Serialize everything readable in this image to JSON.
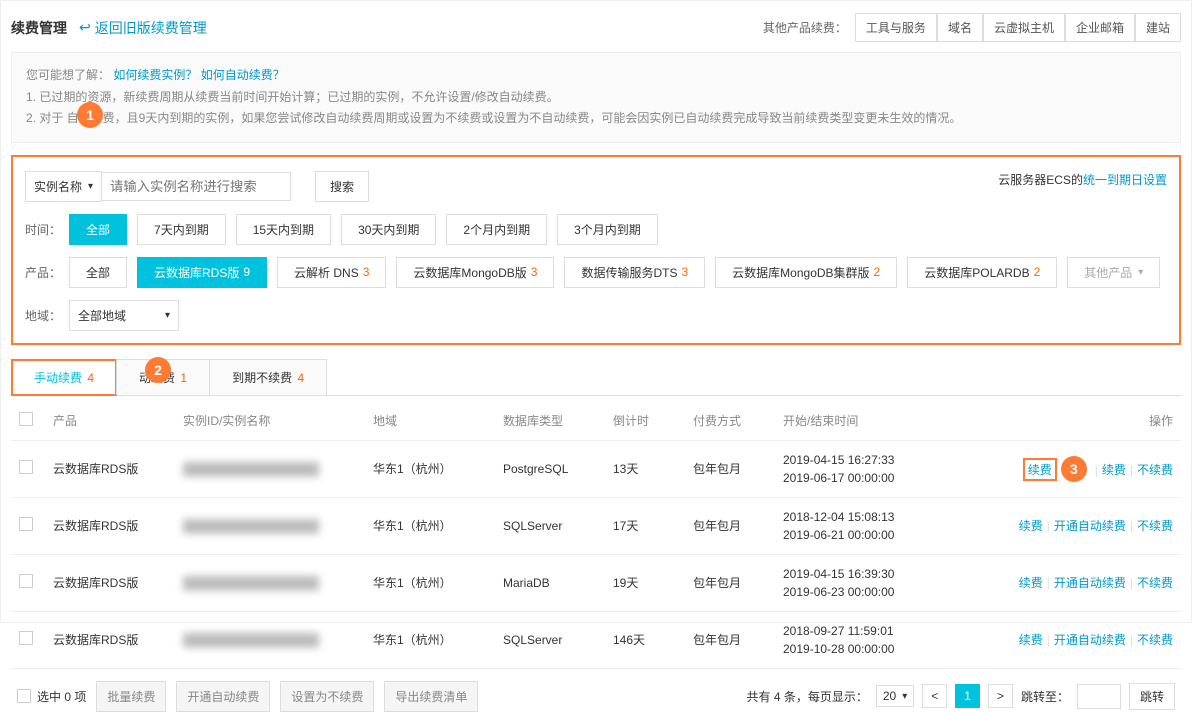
{
  "header": {
    "page_title": "续费管理",
    "back_link": "返回旧版续费管理",
    "other_products_label": "其他产品续费：",
    "tabs": [
      "工具与服务",
      "域名",
      "云虚拟主机",
      "企业邮箱",
      "建站"
    ]
  },
  "info": {
    "intro": "您可能想了解：",
    "link1": "如何续费实例？",
    "link2": "如何自动续费？",
    "line1": "1. 已过期的资源，新续费周期从续费当前时间开始计算；已过期的实例，不允许设置/修改自动续费。",
    "line2": "2. 对于       自动续费，且9天内到期的实例，如果您尝试修改自动续费周期或设置为不续费或设置为不自动续费，可能会因实例已自动续费完成导致当前续费类型变更未生效的情况。"
  },
  "filter": {
    "search_type": "实例名称",
    "search_placeholder": "请输入实例名称进行搜索",
    "search_button": "搜索",
    "right_prefix": "云服务器ECS的",
    "right_link": "统一到期日设置",
    "time_label": "时间：",
    "times": [
      "全部",
      "7天内到期",
      "15天内到期",
      "30天内到期",
      "2个月内到期",
      "3个月内到期"
    ],
    "product_label": "产品：",
    "products": [
      {
        "name": "全部"
      },
      {
        "name": "云数据库RDS版",
        "count": "9"
      },
      {
        "name": "云解析 DNS",
        "count": "3"
      },
      {
        "name": "云数据库MongoDB版",
        "count": "3"
      },
      {
        "name": "数据传输服务DTS",
        "count": "3"
      },
      {
        "name": "云数据库MongoDB集群版",
        "count": "2"
      },
      {
        "name": "云数据库POLARDB",
        "count": "2"
      },
      {
        "name": "其他产品"
      }
    ],
    "region_label": "地域：",
    "region_value": "全部地域"
  },
  "tabs": [
    {
      "label": "手动续费",
      "count": "4"
    },
    {
      "label": "动续费",
      "count": "1"
    },
    {
      "label": "到期不续费",
      "count": "4"
    }
  ],
  "callouts": [
    "1",
    "2",
    "3"
  ],
  "table": {
    "headers": [
      "产品",
      "实例ID/实例名称",
      "地域",
      "数据库类型",
      "倒计时",
      "付费方式",
      "开始/结束时间",
      "操作"
    ],
    "ops": {
      "renew": "续费",
      "enable_auto": "开通自动续费",
      "no_renew": "不续费"
    },
    "rows": [
      {
        "product": "云数据库RDS版",
        "region": "华东1（杭州）",
        "dbtype": "PostgreSQL",
        "countdown": "13天",
        "paytype": "包年包月",
        "start": "2019-04-15 16:27:33",
        "end": "2019-06-17 00:00:00",
        "highlight_renew": true
      },
      {
        "product": "云数据库RDS版",
        "region": "华东1（杭州）",
        "dbtype": "SQLServer",
        "countdown": "17天",
        "paytype": "包年包月",
        "start": "2018-12-04 15:08:13",
        "end": "2019-06-21 00:00:00"
      },
      {
        "product": "云数据库RDS版",
        "region": "华东1（杭州）",
        "dbtype": "MariaDB",
        "countdown": "19天",
        "paytype": "包年包月",
        "start": "2019-04-15 16:39:30",
        "end": "2019-06-23 00:00:00"
      },
      {
        "product": "云数据库RDS版",
        "region": "华东1（杭州）",
        "dbtype": "SQLServer",
        "countdown": "146天",
        "paytype": "包年包月",
        "start": "2018-09-27 11:59:01",
        "end": "2019-10-28 00:00:00"
      }
    ]
  },
  "footer": {
    "selected_label": "选中 0 项",
    "batch_renew": "批量续费",
    "enable_auto": "开通自动续费",
    "set_no_renew": "设置为不续费",
    "export_list": "导出续费清单",
    "total_text": "共有 4 条，每页显示：",
    "page_size": "20",
    "current_page": "1",
    "jump_label": "跳转至：",
    "jump_button": "跳转"
  }
}
